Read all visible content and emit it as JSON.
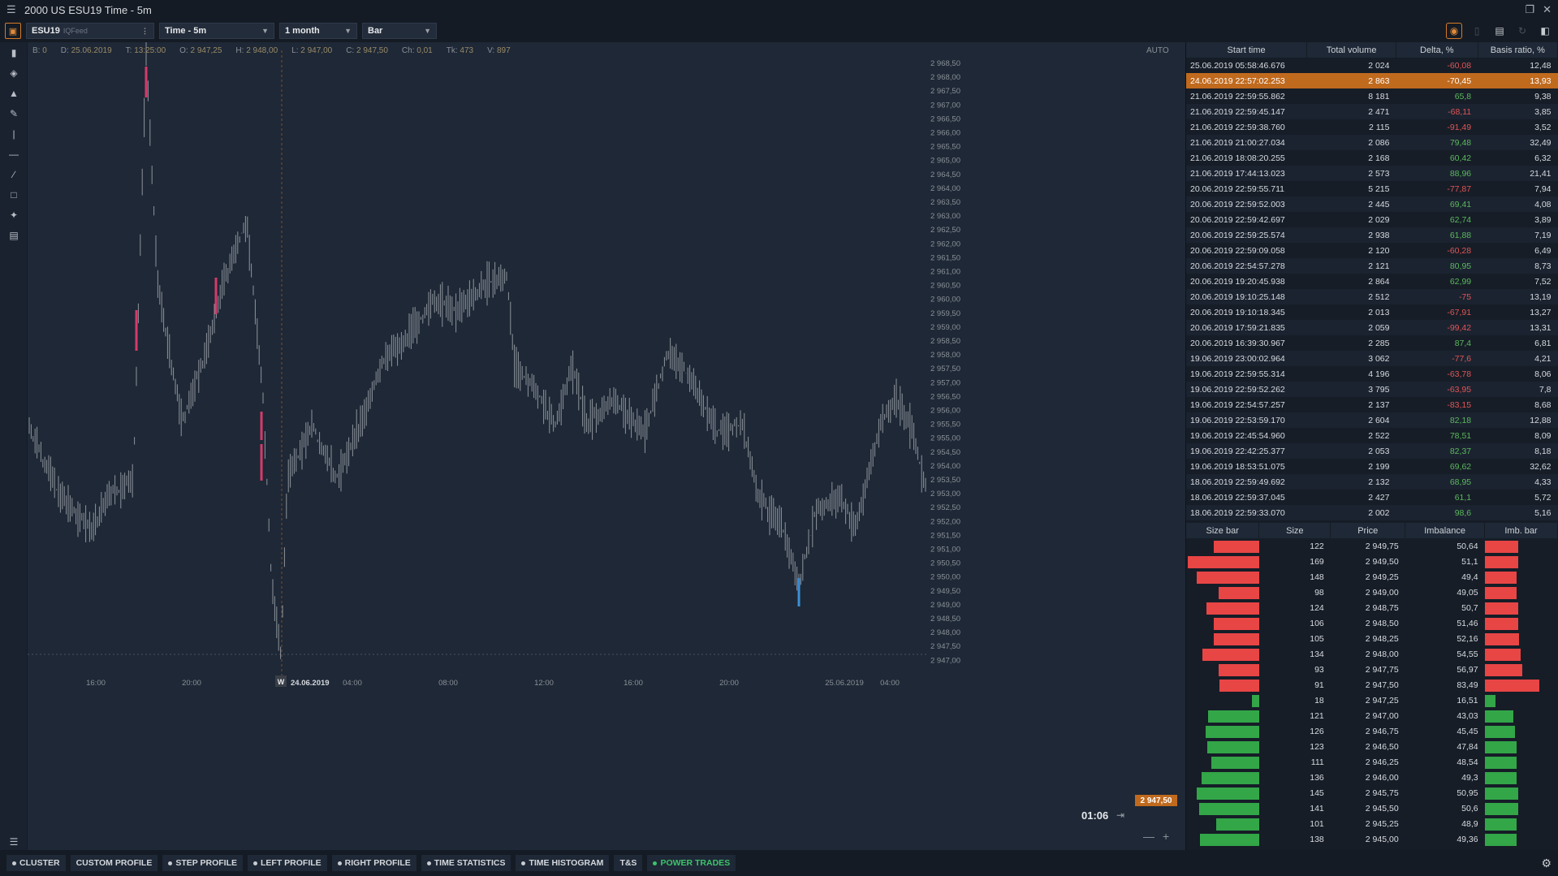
{
  "window": {
    "title": "2000 US ESU19 Time - 5m"
  },
  "toolbar": {
    "symbol": "ESU19",
    "feed": "IQFeed",
    "timeframe": "Time - 5m",
    "period": "1 month",
    "chart_type": "Bar"
  },
  "infobar": {
    "b": "0",
    "d": "25.06.2019",
    "t": "13:25:00",
    "o": "2 947,25",
    "h": "2 948,00",
    "l": "2 947,00",
    "c": "2 947,50",
    "ch": "0,01",
    "tk": "473",
    "v": "897"
  },
  "chart": {
    "auto_label": "AUTO",
    "timer": "01:06",
    "current_price": "2 947,50",
    "date_marker": "24.06.2019",
    "marker_letter": "W",
    "y_ticks": [
      "2 968,50",
      "2 968,00",
      "2 967,50",
      "2 967,00",
      "2 966,50",
      "2 966,00",
      "2 965,50",
      "2 965,00",
      "2 964,50",
      "2 964,00",
      "2 963,50",
      "2 963,00",
      "2 962,50",
      "2 962,00",
      "2 961,50",
      "2 961,00",
      "2 960,50",
      "2 960,00",
      "2 959,50",
      "2 959,00",
      "2 958,50",
      "2 958,00",
      "2 957,50",
      "2 957,00",
      "2 956,50",
      "2 956,00",
      "2 955,50",
      "2 955,00",
      "2 954,50",
      "2 954,00",
      "2 953,50",
      "2 953,00",
      "2 952,50",
      "2 952,00",
      "2 951,50",
      "2 951,00",
      "2 950,50",
      "2 950,00",
      "2 949,50",
      "2 949,00",
      "2 948,50",
      "2 948,00",
      "2 947,50",
      "2 947,00"
    ],
    "x_ticks": [
      "16:00",
      "20:00",
      "04:00",
      "08:00",
      "12:00",
      "16:00",
      "20:00",
      "25.06.2019",
      "04:00"
    ]
  },
  "trades_table": {
    "headers": [
      "Start time",
      "Total volume",
      "Delta, %",
      "Basis ratio, %"
    ],
    "rows": [
      [
        "25.06.2019 05:58:46.676",
        "2 024",
        "-60,08",
        "12,48"
      ],
      [
        "24.06.2019 22:57:02.253",
        "2 863",
        "-70,45",
        "13,93"
      ],
      [
        "21.06.2019 22:59:55.862",
        "8 181",
        "65,8",
        "9,38"
      ],
      [
        "21.06.2019 22:59:45.147",
        "2 471",
        "-68,11",
        "3,85"
      ],
      [
        "21.06.2019 22:59:38.760",
        "2 115",
        "-91,49",
        "3,52"
      ],
      [
        "21.06.2019 21:00:27.034",
        "2 086",
        "79,48",
        "32,49"
      ],
      [
        "21.06.2019 18:08:20.255",
        "2 168",
        "60,42",
        "6,32"
      ],
      [
        "21.06.2019 17:44:13.023",
        "2 573",
        "88,96",
        "21,41"
      ],
      [
        "20.06.2019 22:59:55.711",
        "5 215",
        "-77,87",
        "7,94"
      ],
      [
        "20.06.2019 22:59:52.003",
        "2 445",
        "69,41",
        "4,08"
      ],
      [
        "20.06.2019 22:59:42.697",
        "2 029",
        "62,74",
        "3,89"
      ],
      [
        "20.06.2019 22:59:25.574",
        "2 938",
        "61,88",
        "7,19"
      ],
      [
        "20.06.2019 22:59:09.058",
        "2 120",
        "-60,28",
        "6,49"
      ],
      [
        "20.06.2019 22:54:57.278",
        "2 121",
        "80,95",
        "8,73"
      ],
      [
        "20.06.2019 19:20:45.938",
        "2 864",
        "62,99",
        "7,52"
      ],
      [
        "20.06.2019 19:10:25.148",
        "2 512",
        "-75",
        "13,19"
      ],
      [
        "20.06.2019 19:10:18.345",
        "2 013",
        "-67,91",
        "13,27"
      ],
      [
        "20.06.2019 17:59:21.835",
        "2 059",
        "-99,42",
        "13,31"
      ],
      [
        "20.06.2019 16:39:30.967",
        "2 285",
        "87,4",
        "6,81"
      ],
      [
        "19.06.2019 23:00:02.964",
        "3 062",
        "-77,6",
        "4,21"
      ],
      [
        "19.06.2019 22:59:55.314",
        "4 196",
        "-63,78",
        "8,06"
      ],
      [
        "19.06.2019 22:59:52.262",
        "3 795",
        "-63,95",
        "7,8"
      ],
      [
        "19.06.2019 22:54:57.257",
        "2 137",
        "-83,15",
        "8,68"
      ],
      [
        "19.06.2019 22:53:59.170",
        "2 604",
        "82,18",
        "12,88"
      ],
      [
        "19.06.2019 22:45:54.960",
        "2 522",
        "78,51",
        "8,09"
      ],
      [
        "19.06.2019 22:42:25.377",
        "2 053",
        "82,37",
        "8,18"
      ],
      [
        "19.06.2019 18:53:51.075",
        "2 199",
        "69,62",
        "32,62"
      ],
      [
        "18.06.2019 22:59:49.692",
        "2 132",
        "68,95",
        "4,33"
      ],
      [
        "18.06.2019 22:59:37.045",
        "2 427",
        "61,1",
        "5,72"
      ],
      [
        "18.06.2019 22:59:33.070",
        "2 002",
        "98,6",
        "5,16"
      ]
    ]
  },
  "depth_table": {
    "headers": [
      "Size bar",
      "Size",
      "Price",
      "Imbalance",
      "Imb. bar"
    ],
    "rows": [
      {
        "size": "122",
        "price": "2 949,75",
        "imb": "50,64",
        "side": "red",
        "size_frac": 0.62,
        "imb_frac": 0.61
      },
      {
        "size": "169",
        "price": "2 949,50",
        "imb": "51,1",
        "side": "red",
        "size_frac": 0.98,
        "imb_frac": 0.62
      },
      {
        "size": "148",
        "price": "2 949,25",
        "imb": "49,4",
        "side": "red",
        "size_frac": 0.85,
        "imb_frac": 0.59
      },
      {
        "size": "98",
        "price": "2 949,00",
        "imb": "49,05",
        "side": "red",
        "size_frac": 0.55,
        "imb_frac": 0.59
      },
      {
        "size": "124",
        "price": "2 948,75",
        "imb": "50,7",
        "side": "red",
        "size_frac": 0.72,
        "imb_frac": 0.61
      },
      {
        "size": "106",
        "price": "2 948,50",
        "imb": "51,46",
        "side": "red",
        "size_frac": 0.62,
        "imb_frac": 0.62
      },
      {
        "size": "105",
        "price": "2 948,25",
        "imb": "52,16",
        "side": "red",
        "size_frac": 0.62,
        "imb_frac": 0.63
      },
      {
        "size": "134",
        "price": "2 948,00",
        "imb": "54,55",
        "side": "red",
        "size_frac": 0.78,
        "imb_frac": 0.66
      },
      {
        "size": "93",
        "price": "2 947,75",
        "imb": "56,97",
        "side": "red",
        "size_frac": 0.55,
        "imb_frac": 0.69
      },
      {
        "size": "91",
        "price": "2 947,50",
        "imb": "83,49",
        "side": "red",
        "size_frac": 0.54,
        "imb_frac": 1.0
      },
      {
        "size": "18",
        "price": "2 947,25",
        "imb": "16,51",
        "side": "green",
        "size_frac": 0.1,
        "imb_frac": 0.2
      },
      {
        "size": "121",
        "price": "2 947,00",
        "imb": "43,03",
        "side": "green",
        "size_frac": 0.7,
        "imb_frac": 0.52
      },
      {
        "size": "126",
        "price": "2 946,75",
        "imb": "45,45",
        "side": "green",
        "size_frac": 0.73,
        "imb_frac": 0.55
      },
      {
        "size": "123",
        "price": "2 946,50",
        "imb": "47,84",
        "side": "green",
        "size_frac": 0.71,
        "imb_frac": 0.58
      },
      {
        "size": "111",
        "price": "2 946,25",
        "imb": "48,54",
        "side": "green",
        "size_frac": 0.65,
        "imb_frac": 0.58
      },
      {
        "size": "136",
        "price": "2 946,00",
        "imb": "49,3",
        "side": "green",
        "size_frac": 0.79,
        "imb_frac": 0.59
      },
      {
        "size": "145",
        "price": "2 945,75",
        "imb": "50,95",
        "side": "green",
        "size_frac": 0.85,
        "imb_frac": 0.61
      },
      {
        "size": "141",
        "price": "2 945,50",
        "imb": "50,6",
        "side": "green",
        "size_frac": 0.82,
        "imb_frac": 0.61
      },
      {
        "size": "101",
        "price": "2 945,25",
        "imb": "48,9",
        "side": "green",
        "size_frac": 0.59,
        "imb_frac": 0.59
      },
      {
        "size": "138",
        "price": "2 945,00",
        "imb": "49,36",
        "side": "green",
        "size_frac": 0.81,
        "imb_frac": 0.59
      }
    ]
  },
  "bottom_tabs": [
    {
      "label": "CLUSTER",
      "dot": true
    },
    {
      "label": "CUSTOM PROFILE",
      "dot": false
    },
    {
      "label": "STEP PROFILE",
      "dot": true
    },
    {
      "label": "LEFT PROFILE",
      "dot": true
    },
    {
      "label": "RIGHT PROFILE",
      "dot": true
    },
    {
      "label": "TIME STATISTICS",
      "dot": true
    },
    {
      "label": "TIME HISTOGRAM",
      "dot": true
    },
    {
      "label": "T&S",
      "dot": false
    },
    {
      "label": "POWER TRADES",
      "dot": true,
      "active": true
    }
  ],
  "colors": {
    "accent": "#c06a1e",
    "negative": "#e05555",
    "positive": "#5cb85c",
    "bar_red": "#e84545",
    "bar_green": "#33a648",
    "bar_pink": "#d63a6a",
    "bar_blue": "#3b8fd6"
  }
}
